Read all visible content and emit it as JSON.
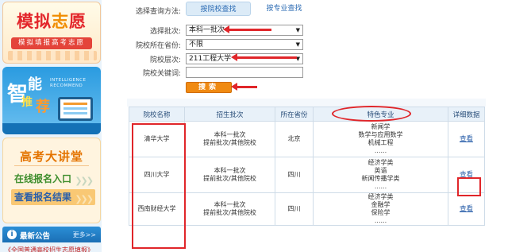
{
  "sidebar": {
    "moni": {
      "title_left": "模拟",
      "title_mid": "志",
      "title_right": "愿",
      "subtitle": "模拟填报高考志愿"
    },
    "zhineng": {
      "chars": [
        "智",
        "能",
        "推",
        "荐"
      ],
      "caption": "INTELLIGENCE RECOMMEND"
    },
    "jiangtang": {
      "title": "高考大讲堂",
      "online_signup": "在线报名入口",
      "view_results": "查看报名结果"
    },
    "notice": {
      "title": "最新公告",
      "more": "更多>>",
      "first_item": "《全国普通高校招生志愿填报》"
    }
  },
  "form": {
    "method_label": "选择查询方法:",
    "tabs": [
      {
        "label": "按院校查找",
        "active": true
      },
      {
        "label": "按专业查找",
        "active": false
      }
    ],
    "batch": {
      "label": "选择批次:",
      "value": "本科一批次"
    },
    "province": {
      "label": "院校所在省份:",
      "value": "不限"
    },
    "level": {
      "label": "院校层次:",
      "value": "211工程大学"
    },
    "keyword": {
      "label": "院校关键词:",
      "value": ""
    },
    "search_button": "搜索"
  },
  "table": {
    "headers": [
      "院校名称",
      "招生批次",
      "所在省份",
      "特色专业",
      "详细数据"
    ],
    "rows": [
      {
        "name": "清华大学",
        "batch_1": "本科一批次",
        "batch_2": "提前批次/其他院校",
        "province": "北京",
        "specialties": [
          "新闻学",
          "数学与应用数学",
          "机械工程",
          "......"
        ],
        "action": "查看"
      },
      {
        "name": "四川大学",
        "batch_1": "本科一批次",
        "batch_2": "提前批次/其他院校",
        "province": "四川",
        "specialties": [
          "经济学类",
          "英语",
          "新闻传播学类",
          "......"
        ],
        "action": "查看"
      },
      {
        "name": "西南财经大学",
        "batch_1": "本科一批次",
        "batch_2": "提前批次/其他院校",
        "province": "四川",
        "specialties": [
          "经济学类",
          "金融学",
          "保险学",
          "......"
        ],
        "action": "查看"
      }
    ]
  },
  "colors": {
    "annotation_red": "#e0262a",
    "accent_orange": "#f08a12",
    "link_blue": "#2a5faa"
  }
}
